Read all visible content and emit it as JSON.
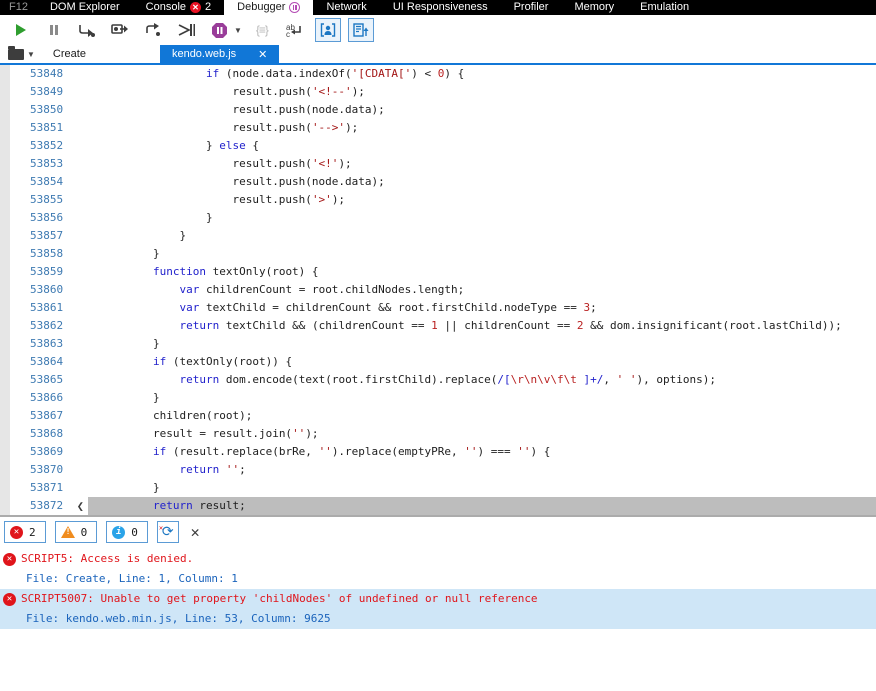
{
  "topbar": {
    "tabs": [
      {
        "label": "F12"
      },
      {
        "label": "DOM Explorer"
      },
      {
        "label": "Console",
        "badge": "2"
      },
      {
        "label": "Debugger",
        "selected": true,
        "icon": "paused-indicator-icon"
      },
      {
        "label": "Network"
      },
      {
        "label": "UI Responsiveness"
      },
      {
        "label": "Profiler"
      },
      {
        "label": "Memory"
      },
      {
        "label": "Emulation"
      }
    ]
  },
  "toolbar": {
    "icons": [
      "continue-icon",
      "break-icon",
      "step-over-icon",
      "step-into-icon",
      "step-out-icon",
      "break-on-new-worker-icon",
      "exception-control-icon",
      "exception-dropdown-caret",
      "pretty-print-icon",
      "word-wrap-icon",
      "just-my-code-icon",
      "source-maps-icon"
    ],
    "format_glyph": "{≡}"
  },
  "filebar": {
    "doc_label": "Create",
    "active_tab": "kendo.web.js",
    "close_glyph": "✕",
    "accent_color": "#1177d7"
  },
  "editor": {
    "scroll_left_glyph": "❮",
    "lines": [
      {
        "n": "53848",
        "indent": 16,
        "segs": [
          [
            "k",
            "if"
          ],
          [
            "p",
            " (node.data.indexOf("
          ],
          [
            "s",
            "'[CDATA['"
          ],
          [
            "p",
            ") < "
          ],
          [
            "n",
            "0"
          ],
          [
            "p",
            ") {"
          ]
        ]
      },
      {
        "n": "53849",
        "indent": 20,
        "segs": [
          [
            "p",
            "result.push("
          ],
          [
            "s",
            "'<!--'"
          ],
          [
            "p",
            ");"
          ]
        ]
      },
      {
        "n": "53850",
        "indent": 20,
        "segs": [
          [
            "p",
            "result.push(node.data);"
          ]
        ]
      },
      {
        "n": "53851",
        "indent": 20,
        "segs": [
          [
            "p",
            "result.push("
          ],
          [
            "s",
            "'-->'"
          ],
          [
            "p",
            ");"
          ]
        ]
      },
      {
        "n": "53852",
        "indent": 16,
        "segs": [
          [
            "p",
            "} "
          ],
          [
            "k",
            "else"
          ],
          [
            "p",
            " {"
          ]
        ]
      },
      {
        "n": "53853",
        "indent": 20,
        "segs": [
          [
            "p",
            "result.push("
          ],
          [
            "s",
            "'<!'"
          ],
          [
            "p",
            ");"
          ]
        ]
      },
      {
        "n": "53854",
        "indent": 20,
        "segs": [
          [
            "p",
            "result.push(node.data);"
          ]
        ]
      },
      {
        "n": "53855",
        "indent": 20,
        "segs": [
          [
            "p",
            "result.push("
          ],
          [
            "s",
            "'>'"
          ],
          [
            "p",
            ");"
          ]
        ]
      },
      {
        "n": "53856",
        "indent": 16,
        "segs": [
          [
            "p",
            "}"
          ]
        ]
      },
      {
        "n": "53857",
        "indent": 12,
        "segs": [
          [
            "p",
            "}"
          ]
        ]
      },
      {
        "n": "53858",
        "indent": 8,
        "segs": [
          [
            "p",
            "}"
          ]
        ]
      },
      {
        "n": "53859",
        "indent": 8,
        "segs": [
          [
            "k",
            "function"
          ],
          [
            "p",
            " textOnly(root) {"
          ]
        ]
      },
      {
        "n": "53860",
        "indent": 12,
        "segs": [
          [
            "k",
            "var"
          ],
          [
            "p",
            " childrenCount = root.childNodes.length;"
          ]
        ]
      },
      {
        "n": "53861",
        "indent": 12,
        "segs": [
          [
            "k",
            "var"
          ],
          [
            "p",
            " textChild = childrenCount && root.firstChild.nodeType == "
          ],
          [
            "n",
            "3"
          ],
          [
            "p",
            ";"
          ]
        ]
      },
      {
        "n": "53862",
        "indent": 12,
        "segs": [
          [
            "k",
            "return"
          ],
          [
            "p",
            " textChild && (childrenCount == "
          ],
          [
            "n",
            "1"
          ],
          [
            "p",
            " || childrenCount == "
          ],
          [
            "n",
            "2"
          ],
          [
            "p",
            " && dom.insignificant(root.lastChild));"
          ]
        ]
      },
      {
        "n": "53863",
        "indent": 8,
        "segs": [
          [
            "p",
            "}"
          ]
        ]
      },
      {
        "n": "53864",
        "indent": 8,
        "segs": [
          [
            "k",
            "if"
          ],
          [
            "p",
            " (textOnly(root)) {"
          ]
        ]
      },
      {
        "n": "53865",
        "indent": 12,
        "segs": [
          [
            "k",
            "return"
          ],
          [
            "p",
            " dom.encode(text(root.firstChild).replace("
          ],
          [
            "k",
            "/["
          ],
          [
            "n",
            "\\r\\n\\v\\f\\t "
          ],
          [
            "k",
            "]+/"
          ],
          [
            "p",
            ", "
          ],
          [
            "s",
            "' '"
          ],
          [
            "p",
            "), options);"
          ]
        ]
      },
      {
        "n": "53866",
        "indent": 8,
        "segs": [
          [
            "p",
            "}"
          ]
        ]
      },
      {
        "n": "53867",
        "indent": 8,
        "segs": [
          [
            "p",
            "children(root);"
          ]
        ]
      },
      {
        "n": "53868",
        "indent": 8,
        "segs": [
          [
            "p",
            "result = result.join("
          ],
          [
            "s",
            "''"
          ],
          [
            "p",
            ");"
          ]
        ]
      },
      {
        "n": "53869",
        "indent": 8,
        "segs": [
          [
            "k",
            "if"
          ],
          [
            "p",
            " (result.replace(brRe, "
          ],
          [
            "s",
            "''"
          ],
          [
            "p",
            ").replace(emptyPRe, "
          ],
          [
            "s",
            "''"
          ],
          [
            "p",
            ") === "
          ],
          [
            "s",
            "''"
          ],
          [
            "p",
            ") {"
          ]
        ]
      },
      {
        "n": "53870",
        "indent": 12,
        "segs": [
          [
            "k",
            "return"
          ],
          [
            "p",
            " "
          ],
          [
            "s",
            "''"
          ],
          [
            "p",
            ";"
          ]
        ]
      },
      {
        "n": "53871",
        "indent": 8,
        "segs": [
          [
            "p",
            "}"
          ]
        ]
      },
      {
        "n": "53872",
        "indent": 8,
        "segs": [
          [
            "k",
            "return"
          ],
          [
            "p",
            " result;"
          ]
        ],
        "current": true
      }
    ]
  },
  "console": {
    "toolbar": {
      "error_count": "2",
      "warning_count": "0",
      "info_count": "0",
      "icons": [
        "errors-filter-icon",
        "warnings-filter-icon",
        "info-filter-icon",
        "clear-on-navigate-icon",
        "clear-console-icon"
      ]
    },
    "entries": [
      {
        "kind": "error",
        "text": "SCRIPT5: Access is denied.",
        "selected": false
      },
      {
        "kind": "file",
        "text": "File: Create, Line: 1, Column: 1",
        "selected": false
      },
      {
        "kind": "error",
        "text": "SCRIPT5007: Unable to get property 'childNodes' of undefined or null reference",
        "selected": true
      },
      {
        "kind": "file",
        "text": "File: kendo.web.min.js, Line: 53, Column: 9625",
        "selected": true
      }
    ]
  },
  "colors": {
    "accent_blue": "#1177d7",
    "keyword_blue": "#2222cc",
    "string_maroon": "#a31515",
    "number_red": "#b92121",
    "line_number_blue": "#3e7ab2",
    "error_red": "#e0151b",
    "file_link_blue": "#1a63bb",
    "selected_row_bg": "#cfe6f7",
    "current_line_gray": "#bdbdbd",
    "exception_purple": "#993d99"
  }
}
